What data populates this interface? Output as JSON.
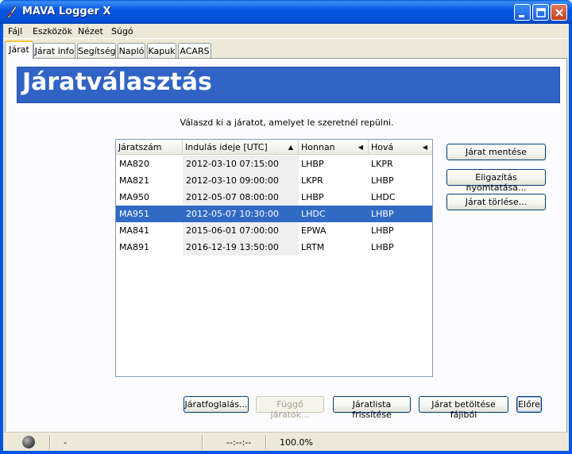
{
  "window": {
    "title": "MAVA Logger X"
  },
  "menu": [
    "Fájl",
    "Eszközök",
    "Nézet",
    "Súgó"
  ],
  "tabs": [
    "Járat",
    "Járat info",
    "Segítség",
    "Napló",
    "Kapuk",
    "ACARS"
  ],
  "active_tab": 0,
  "page": {
    "heading": "Járatválasztás",
    "instruction": "Válaszd ki a járatot, amelyet le szeretnél repülni."
  },
  "table": {
    "columns": [
      "Járatszám",
      "Indulás ideje [UTC]",
      "Honnan",
      "Hová"
    ],
    "sort_column": 1,
    "rows": [
      [
        "MA820",
        "2012-03-10 07:15:00",
        "LHBP",
        "LKPR"
      ],
      [
        "MA821",
        "2012-03-10 09:00:00",
        "LKPR",
        "LHBP"
      ],
      [
        "MA950",
        "2012-05-07 08:00:00",
        "LHBP",
        "LHDC"
      ],
      [
        "MA951",
        "2012-05-07 10:30:00",
        "LHDC",
        "LHBP"
      ],
      [
        "MA841",
        "2015-06-01 07:00:00",
        "EPWA",
        "LHBP"
      ],
      [
        "MA891",
        "2016-12-19 13:50:00",
        "LRTM",
        "LHBP"
      ]
    ],
    "selected_row": 3
  },
  "side_buttons": {
    "save": "Járat mentése",
    "print": "Eligazítás nyomtatása...",
    "delete": "Járat törlése..."
  },
  "bottom_buttons": {
    "book": "Járatfoglalás...",
    "pending": "Függő járatok...",
    "refresh": "Járatlista frissítése",
    "load_file": "Járat betöltése fájlból",
    "next": "Előre"
  },
  "status": {
    "left_text": "-",
    "time": "--:--:--",
    "percent": "100.0%"
  },
  "colors": {
    "titlebar": "#0054e3",
    "header_band": "#3163c5",
    "selection": "#316ac5"
  }
}
